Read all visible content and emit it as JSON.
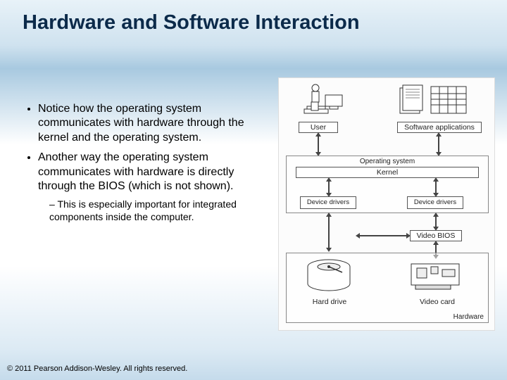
{
  "title": "Hardware and Software Interaction",
  "bullets": {
    "b1": "Notice how the operating system communicates with hardware through the kernel and the operating system.",
    "b2": "Another way the operating system communicates with hardware is directly through the BIOS (which is not shown).",
    "sub1": "This is especially important for integrated components inside the computer."
  },
  "diagram": {
    "user": "User",
    "software": "Software applications",
    "os_group": "Operating system",
    "kernel": "Kernel",
    "device_drivers_left": "Device drivers",
    "device_drivers_right": "Device drivers",
    "video_bios": "Video BIOS",
    "hard_drive": "Hard drive",
    "video_card": "Video card",
    "hardware_group": "Hardware"
  },
  "copyright": "© 2011 Pearson Addison-Wesley. All rights reserved."
}
